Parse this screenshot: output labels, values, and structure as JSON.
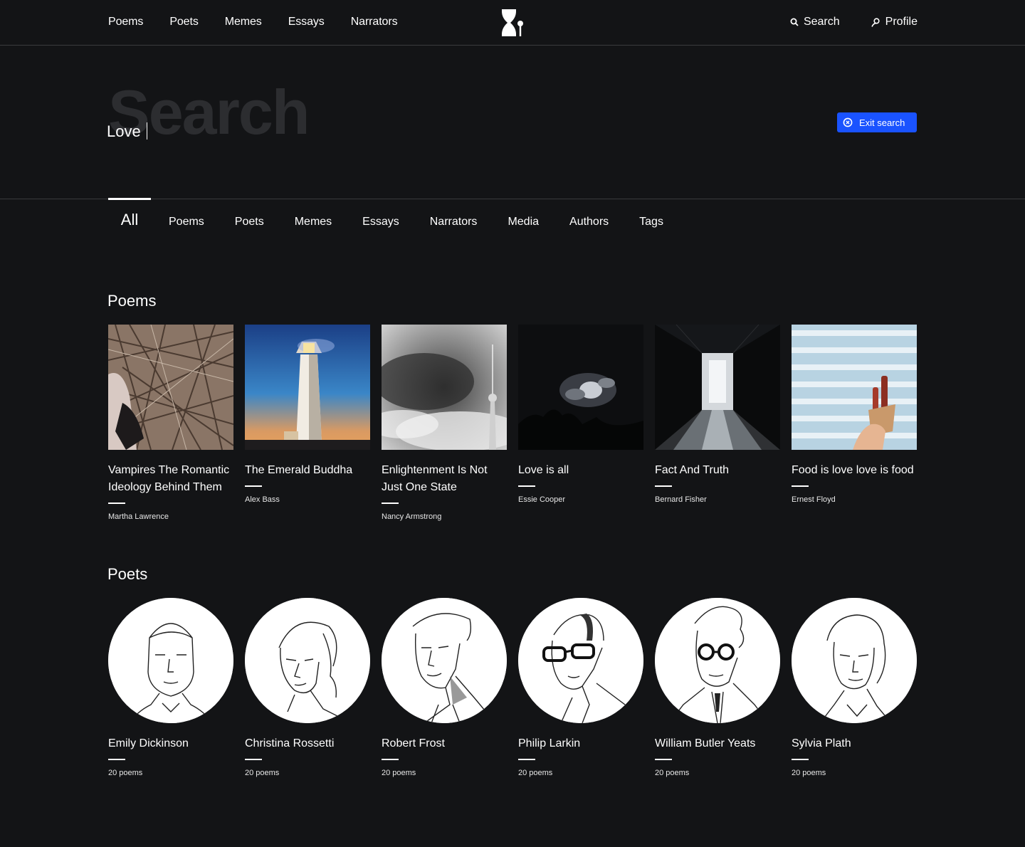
{
  "topnav": {
    "items": [
      "Poems",
      "Poets",
      "Memes",
      "Essays",
      "Narrators"
    ],
    "search_label": "Search",
    "profile_label": "Profile"
  },
  "search": {
    "ghost_title": "Search",
    "value": "Love",
    "exit_label": "Exit search"
  },
  "tabs": [
    "All",
    "Poems",
    "Poets",
    "Memes",
    "Essays",
    "Narrators",
    "Media",
    "Authors",
    "Tags"
  ],
  "poems": {
    "title": "Poems",
    "items": [
      {
        "title": "Vampires The Romantic Ideology Behind Them",
        "author": "Martha Lawrence"
      },
      {
        "title": "The Emerald Buddha",
        "author": "Alex Bass"
      },
      {
        "title": "Enlightenment Is Not Just One State",
        "author": "Nancy Armstrong"
      },
      {
        "title": "Love is all",
        "author": "Essie Cooper"
      },
      {
        "title": "Fact And Truth",
        "author": "Bernard Fisher"
      },
      {
        "title": "Food is love love is food",
        "author": "Ernest Floyd"
      }
    ]
  },
  "poets": {
    "title": "Poets",
    "items": [
      {
        "name": "Emily Dickinson",
        "count": "20 poems"
      },
      {
        "name": "Christina Rossetti",
        "count": "20 poems"
      },
      {
        "name": "Robert Frost",
        "count": "20 poems"
      },
      {
        "name": "Philip Larkin",
        "count": "20 poems"
      },
      {
        "name": "William Butler Yeats",
        "count": "20 poems"
      },
      {
        "name": "Sylvia Plath",
        "count": "20 poems"
      }
    ]
  },
  "colors": {
    "background": "#131416",
    "accent": "#1a53ff"
  }
}
